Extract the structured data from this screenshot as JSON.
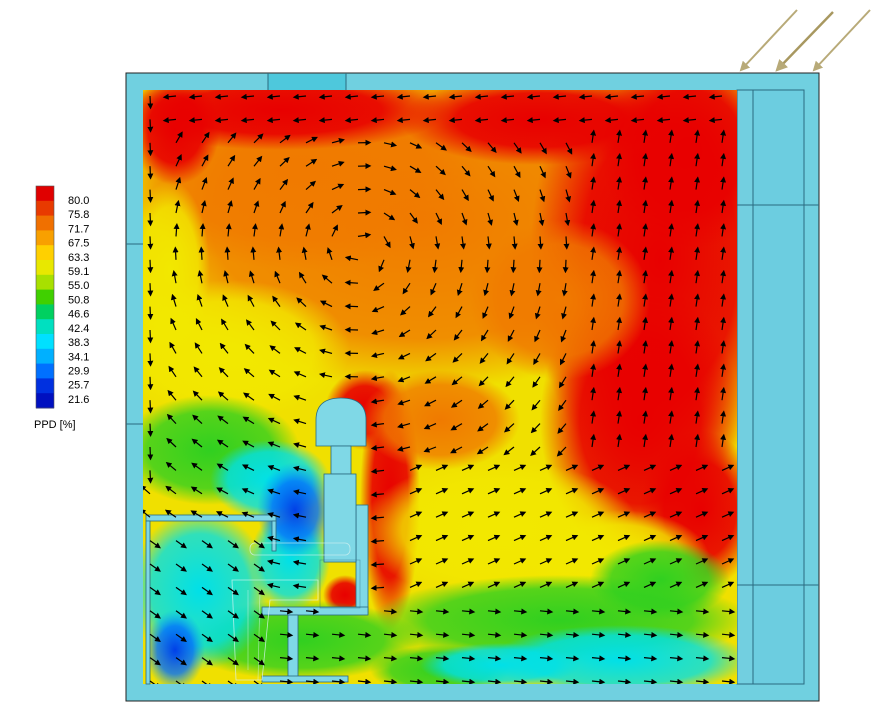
{
  "legend": {
    "title": "PPD [%]",
    "ticks": [
      "80.0",
      "75.8",
      "71.7",
      "67.5",
      "63.3",
      "59.1",
      "55.0",
      "50.8",
      "46.6",
      "42.4",
      "38.3",
      "34.1",
      "29.9",
      "25.7",
      "21.6"
    ],
    "colors": [
      "#e00000",
      "#e83a00",
      "#f07000",
      "#f8a000",
      "#ffd000",
      "#e8e800",
      "#a8e000",
      "#40d000",
      "#00d060",
      "#00e0c0",
      "#00e0ff",
      "#00b0ff",
      "#0070ff",
      "#0030e0",
      "#0010c0"
    ]
  },
  "room": {
    "wall_color": "#70d0e0",
    "floor_color": "#7fd8e6",
    "sun_arrow_color": "#b8aa78"
  }
}
